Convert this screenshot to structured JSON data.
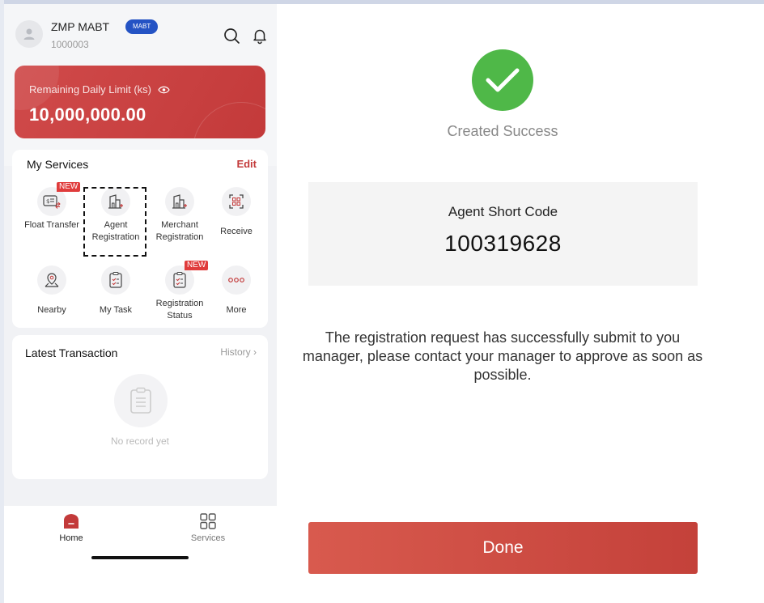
{
  "user": {
    "name": "ZMP MABT",
    "id": "1000003",
    "role_badge": "MABT"
  },
  "limit": {
    "label": "Remaining Daily Limit (ks)",
    "value": "10,000,000.00"
  },
  "services": {
    "title": "My Services",
    "edit_label": "Edit",
    "items": [
      {
        "label": "Float Transfer",
        "badge": "NEW",
        "icon": "float-transfer-icon"
      },
      {
        "label": "Agent Registration",
        "badge": "",
        "icon": "agent-registration-icon",
        "selected": true
      },
      {
        "label": "Merchant Registration",
        "badge": "",
        "icon": "merchant-registration-icon"
      },
      {
        "label": "Receive",
        "badge": "",
        "icon": "qr-receive-icon"
      },
      {
        "label": "Nearby",
        "badge": "",
        "icon": "map-pin-icon"
      },
      {
        "label": "My Task",
        "badge": "",
        "icon": "task-list-icon"
      },
      {
        "label": "Registration Status",
        "badge": "NEW",
        "icon": "registration-status-icon"
      },
      {
        "label": "More",
        "badge": "",
        "icon": "more-dots-icon"
      }
    ]
  },
  "latest": {
    "title": "Latest Transaction",
    "history_label": "History",
    "empty_text": "No record yet"
  },
  "tabbar": {
    "home_label": "Home",
    "services_label": "Services"
  },
  "result": {
    "status_text": "Created Success",
    "code_label": "Agent Short Code",
    "code_value": "100319628",
    "message": "The registration request has successfully submit to you manager, please contact your manager to approve as soon as possible.",
    "done_label": "Done"
  },
  "colors": {
    "brand_red": "#c33a3a",
    "success_green": "#4fb848",
    "badge_blue": "#2453c4"
  }
}
